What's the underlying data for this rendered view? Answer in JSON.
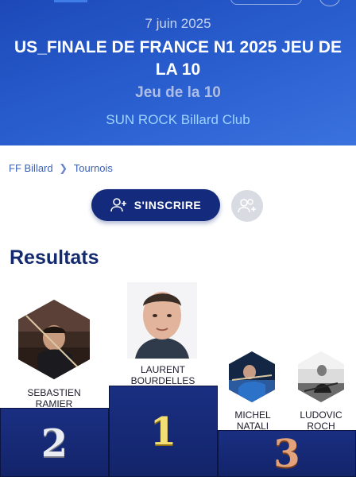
{
  "header": {
    "date": "7 juin 2025",
    "title": "US_FINALE DE FRANCE N1 2025 JEU DE LA 10",
    "subtitle": "Jeu de la 10",
    "club": "SUN ROCK Billard Club"
  },
  "breadcrumb": {
    "items": [
      "FF Billard",
      "Tournois"
    ],
    "separator": "❯"
  },
  "actions": {
    "inscrire_label": "S'INSCRIRE"
  },
  "results": {
    "heading": "Resultats",
    "podium": [
      {
        "place": "1",
        "name_line1": "LAURENT",
        "name_line2": "BOURDELLES"
      },
      {
        "place": "2",
        "name_line1": "SEBASTIEN",
        "name_line2": "RAMIER"
      },
      {
        "place": "3",
        "name_line1": "MICHEL",
        "name_line2": "NATALI"
      },
      {
        "place": "3",
        "name_line1": "LUDOVIC",
        "name_line2": "ROCH"
      }
    ]
  },
  "colors": {
    "header_blue": "#2a5fd0",
    "navy": "#142a7c",
    "gold": "#f4df74",
    "silver": "#e9ecf3",
    "bronze": "#e2a27a"
  }
}
